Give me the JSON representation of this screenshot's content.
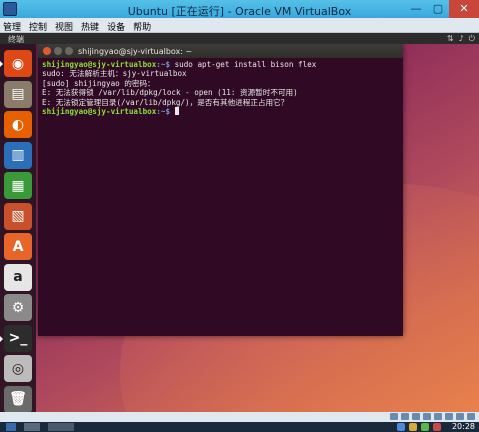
{
  "window": {
    "title": "Ubuntu [正在运行] - Oracle VM VirtualBox",
    "controls": [
      "—",
      "▢",
      "✕"
    ]
  },
  "vbox_menu": [
    "管理",
    "控制",
    "视图",
    "热键",
    "设备",
    "帮助"
  ],
  "ubuntu": {
    "topbar_title": "终端"
  },
  "terminal": {
    "title": "shijingyao@sjy-virtualbox: ~",
    "lines": [
      {
        "user": "shijingyao@sjy-virtualbox",
        "path": ":~$",
        "text": " sudo apt-get install bison flex"
      },
      {
        "text": "sudo: 无法解析主机：sjy-virtualbox"
      },
      {
        "text": "[sudo] shijingyao 的密码："
      },
      {
        "text": "E: 无法获得锁 /var/lib/dpkg/lock - open (11: 资源暂时不可用)"
      },
      {
        "text": "E: 无法锁定管理目录(/var/lib/dpkg/)，是否有其他进程正占用它？"
      },
      {
        "user": "shijingyao@sjy-virtualbox",
        "path": ":~$",
        "text": " "
      }
    ]
  },
  "launcher": [
    {
      "name": "dash-home-icon",
      "glyph": "◉",
      "color": "#dd4814"
    },
    {
      "name": "files-icon",
      "glyph": "▤",
      "color": "#8a7b6a"
    },
    {
      "name": "firefox-icon",
      "glyph": "◐",
      "color": "#e66000"
    },
    {
      "name": "writer-icon",
      "glyph": "▥",
      "color": "#2a6fb8"
    },
    {
      "name": "calc-icon",
      "glyph": "▦",
      "color": "#3a9a3a"
    },
    {
      "name": "impress-icon",
      "glyph": "▧",
      "color": "#c8502a"
    },
    {
      "name": "software-center-icon",
      "glyph": "A",
      "color": "#e8652a"
    },
    {
      "name": "amazon-icon",
      "glyph": "a",
      "color": "#e6e6e6"
    },
    {
      "name": "settings-icon",
      "glyph": "⚙",
      "color": "#8a8a8a"
    },
    {
      "name": "terminal-icon",
      "glyph": ">_",
      "color": "#2c2c2c"
    },
    {
      "name": "dvd-icon",
      "glyph": "◎",
      "color": "#bcbcbc"
    },
    {
      "name": "trash-icon",
      "glyph": "🗑",
      "color": "#6a6a6a"
    }
  ],
  "taskbar": {
    "clock": "20:28"
  }
}
